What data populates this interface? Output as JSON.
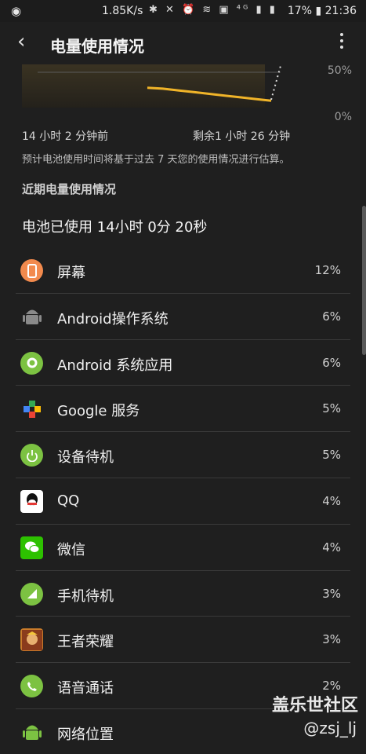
{
  "status": {
    "left_icon": "wechat-icon",
    "speed": "1.85K/s",
    "battery": "17%",
    "time": "21:36",
    "icons": [
      "bluetooth-icon",
      "mute-icon",
      "alarm-icon",
      "wifi-icon",
      "nfc-icon",
      "4g-icon",
      "signal-icon",
      "battery-icon"
    ]
  },
  "appbar": {
    "title": "电量使用情况",
    "back_icon": "back-arrow-icon",
    "more_icon": "more-vert-icon"
  },
  "chart": {
    "y_ticks": [
      "50%",
      "0%"
    ],
    "x_left": "14 小时 2 分钟前",
    "x_right": "剩余1 小时 26 分钟",
    "note": "预计电池使用时间将基于过去 7 天您的使用情况进行估算。",
    "line_color": "#f0b429"
  },
  "chart_data": {
    "type": "line",
    "series": [
      {
        "values": [
          32,
          31,
          29,
          27,
          25,
          23,
          21,
          19,
          17
        ]
      }
    ],
    "ylim": [
      0,
      50
    ]
  },
  "section_title": "近期电量使用情况",
  "total_usage": "电池已使用 14小时 0分 20秒",
  "apps": [
    {
      "name": "屏幕",
      "percent": "12%",
      "icon": "screen-icon",
      "color": "#f28a4d"
    },
    {
      "name": "Android操作系统",
      "percent": "6%",
      "icon": "android-icon",
      "color": "#8a8a8a"
    },
    {
      "name": "Android 系统应用",
      "percent": "6%",
      "icon": "android-system-app-icon",
      "color": "#7cc242"
    },
    {
      "name": "Google 服务",
      "percent": "5%",
      "icon": "google-play-services-icon",
      "color": "#4285f4"
    },
    {
      "name": "设备待机",
      "percent": "5%",
      "icon": "power-standby-icon",
      "color": "#7cc242"
    },
    {
      "name": "QQ",
      "percent": "4%",
      "icon": "qq-icon",
      "color": "#ffffff"
    },
    {
      "name": "微信",
      "percent": "4%",
      "icon": "wechat-app-icon",
      "color": "#2dc100"
    },
    {
      "name": "手机待机",
      "percent": "3%",
      "icon": "cell-standby-icon",
      "color": "#7cc242"
    },
    {
      "name": "王者荣耀",
      "percent": "3%",
      "icon": "honor-of-kings-icon",
      "color": "#c97b2a"
    },
    {
      "name": "语音通话",
      "percent": "2%",
      "icon": "phone-call-icon",
      "color": "#7cc242"
    },
    {
      "name": "网络位置",
      "percent": "",
      "icon": "android-location-icon",
      "color": "#7cc242"
    }
  ],
  "watermark": {
    "site": "盖乐世社区",
    "user": "@zsj_lj"
  }
}
